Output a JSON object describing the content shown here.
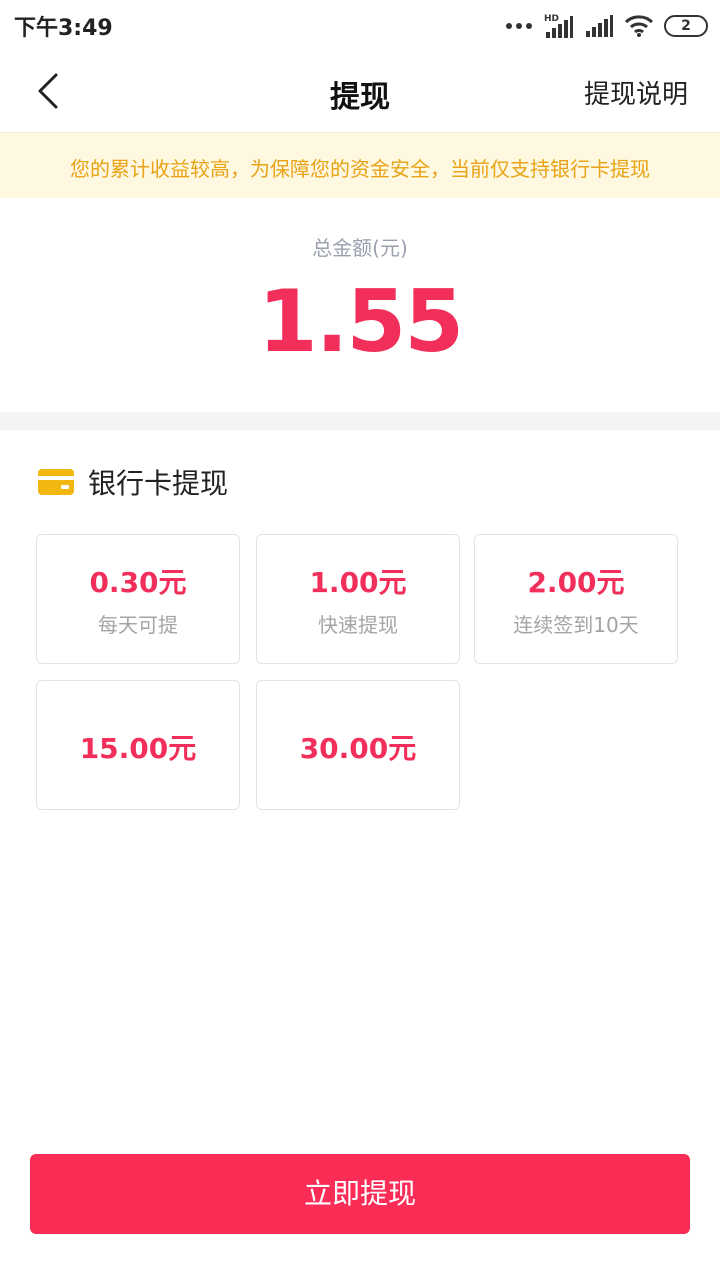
{
  "status": {
    "time": "下午3:49",
    "battery": "2",
    "network_badge": "HD"
  },
  "nav": {
    "title": "提现",
    "right_link": "提现说明"
  },
  "notice": {
    "text": "您的累计收益较高，为保障您的资金安全，当前仅支持银行卡提现"
  },
  "summary": {
    "label": "总金额(元)",
    "amount": "1.55"
  },
  "bank_section": {
    "title": "银行卡提现",
    "icon": "bank-card-icon"
  },
  "options": [
    {
      "amount": "0.30元",
      "desc": "每天可提"
    },
    {
      "amount": "1.00元",
      "desc": "快速提现"
    },
    {
      "amount": "2.00元",
      "desc": "连续签到10天"
    },
    {
      "amount": "15.00元",
      "desc": ""
    },
    {
      "amount": "30.00元",
      "desc": ""
    }
  ],
  "actions": {
    "submit": "立即提现"
  },
  "colors": {
    "accent": "#f12f5a",
    "button": "#fb2d57",
    "notice_bg": "#fff8e1",
    "notice_text": "#e8a317",
    "card_icon": "#f2b80f"
  }
}
